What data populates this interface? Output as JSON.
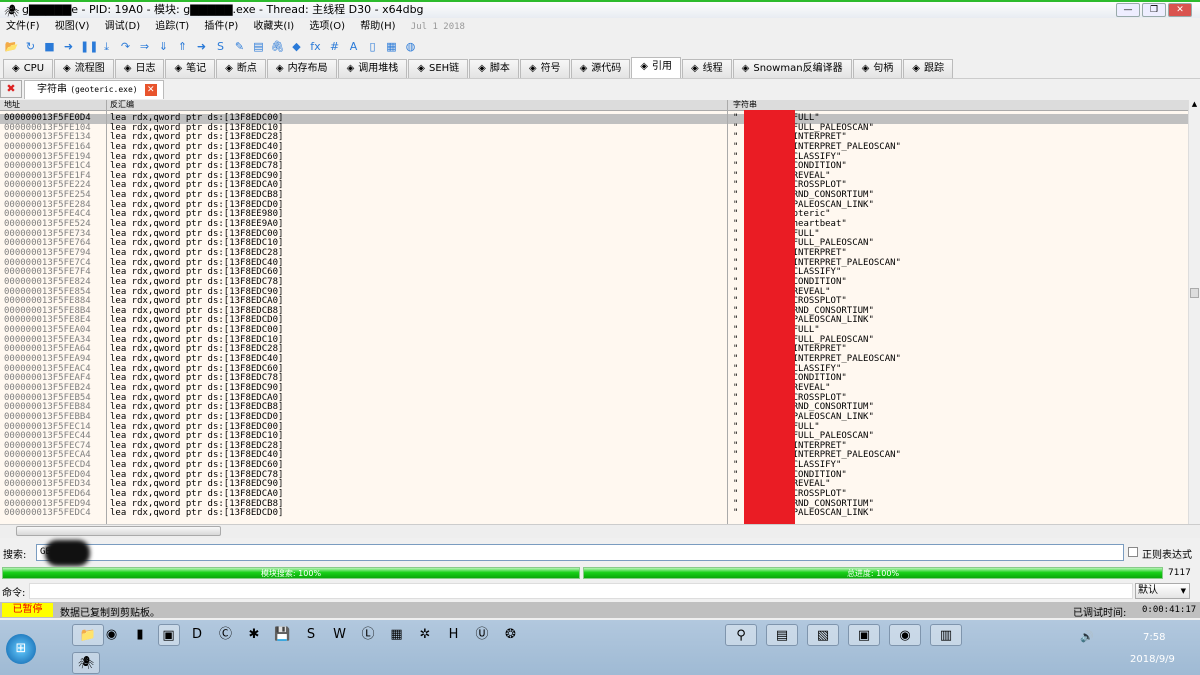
{
  "window": {
    "title": "g▇▇▇▇▇e - PID: 19A0 - 模块: g▇▇▇▇▇.exe - Thread: 主线程 D30 - x64dbg",
    "minimize": "—",
    "restore": "❐",
    "close": "✕"
  },
  "menu": {
    "items": [
      "文件(F)",
      "视图(V)",
      "调试(D)",
      "追踪(T)",
      "插件(P)",
      "收藏夹(I)",
      "选项(O)",
      "帮助(H)"
    ],
    "date": "Jul 1 2018"
  },
  "toolbar": {
    "icons": [
      "open-icon",
      "restart-icon",
      "stop-icon",
      "run-icon",
      "pause-icon",
      "step-into-icon",
      "step-over-icon",
      "trace-into-icon",
      "trace-over-icon",
      "execute-till-return-icon",
      "run-to-user-code-icon",
      "scylla-icon",
      "patch-icon",
      "comment-icon",
      "link-icon",
      "label-icon",
      "fx-icon",
      "hash-icon",
      "font-icon",
      "device-icon",
      "calculator-icon",
      "globe-icon"
    ],
    "glyphs": [
      "📂",
      "↻",
      "■",
      "➜",
      "❚❚",
      "⤓",
      "↷",
      "⇒",
      "⇓",
      "⇑",
      "➜",
      "S",
      "✎",
      "▤",
      "🖇",
      "◆",
      "fx",
      "#",
      "A",
      "▯",
      "▦",
      "◍"
    ]
  },
  "tabs": [
    {
      "label": "CPU",
      "icon": "cpu-icon"
    },
    {
      "label": "流程图",
      "icon": "tree-icon"
    },
    {
      "label": "日志",
      "icon": "log-icon"
    },
    {
      "label": "笔记",
      "icon": "notes-icon"
    },
    {
      "label": "断点",
      "icon": "breakpoint-icon"
    },
    {
      "label": "内存布局",
      "icon": "memory-icon"
    },
    {
      "label": "调用堆栈",
      "icon": "callstack-icon"
    },
    {
      "label": "SEH链",
      "icon": "seh-icon"
    },
    {
      "label": "脚本",
      "icon": "script-icon"
    },
    {
      "label": "符号",
      "icon": "symbol-icon"
    },
    {
      "label": "源代码",
      "icon": "source-icon"
    },
    {
      "label": "引用",
      "icon": "search-icon",
      "active": true
    },
    {
      "label": "线程",
      "icon": "thread-icon"
    },
    {
      "label": "Snowman反编译器",
      "icon": "snowman-icon"
    },
    {
      "label": "句柄",
      "icon": "handle-icon"
    },
    {
      "label": "跟踪",
      "icon": "trace-icon"
    }
  ],
  "subtab": {
    "label": "字符串",
    "module": "(geoteric.exe)",
    "close": "✕",
    "close_all": "✖"
  },
  "grid": {
    "headers": [
      "地址",
      "反汇编",
      "字符串"
    ],
    "addresses": [
      "000000013F5FE0D4",
      "000000013F5FE104",
      "000000013F5FE134",
      "000000013F5FE164",
      "000000013F5FE194",
      "000000013F5FE1C4",
      "000000013F5FE1F4",
      "000000013F5FE224",
      "000000013F5FE254",
      "000000013F5FE284",
      "000000013F5FE4C4",
      "000000013F5FE524",
      "000000013F5FE734",
      "000000013F5FE764",
      "000000013F5FE794",
      "000000013F5FE7C4",
      "000000013F5FE7F4",
      "000000013F5FE824",
      "000000013F5FE854",
      "000000013F5FE884",
      "000000013F5FE8B4",
      "000000013F5FE8E4",
      "000000013F5FEA04",
      "000000013F5FEA34",
      "000000013F5FEA64",
      "000000013F5FEA94",
      "000000013F5FEAC4",
      "000000013F5FEAF4",
      "000000013F5FEB24",
      "000000013F5FEB54",
      "000000013F5FEB84",
      "000000013F5FEBB4",
      "000000013F5FEC14",
      "000000013F5FEC44",
      "000000013F5FEC74",
      "000000013F5FECA4",
      "000000013F5FECD4",
      "000000013F5FED04",
      "000000013F5FED34",
      "000000013F5FED64",
      "000000013F5FED94",
      "000000013F5FEDC4"
    ],
    "instruction_prefix": "lea rdx,qword ptr ds:",
    "operands": [
      "13F8EDC00",
      "13F8EDC10",
      "13F8EDC28",
      "13F8EDC40",
      "13F8EDC60",
      "13F8EDC78",
      "13F8EDC90",
      "13F8EDCA0",
      "13F8EDCB8",
      "13F8EDCD0",
      "13F8EE980",
      "13F8EE9A0",
      "13F8EDC00",
      "13F8EDC10",
      "13F8EDC28",
      "13F8EDC40",
      "13F8EDC60",
      "13F8EDC78",
      "13F8EDC90",
      "13F8EDCA0",
      "13F8EDCB8",
      "13F8EDCD0",
      "13F8EDC00",
      "13F8EDC10",
      "13F8EDC28",
      "13F8EDC40",
      "13F8EDC60",
      "13F8EDC78",
      "13F8EDC90",
      "13F8EDCA0",
      "13F8EDCB8",
      "13F8EDCD0",
      "13F8EDC00",
      "13F8EDC10",
      "13F8EDC28",
      "13F8EDC40",
      "13F8EDC60",
      "13F8EDC78",
      "13F8EDC90",
      "13F8EDCA0",
      "13F8EDCB8",
      "13F8EDCD0"
    ],
    "strings": [
      "FULL\"",
      "FULL_PALEOSCAN\"",
      "INTERPRET\"",
      "INTERPRET_PALEOSCAN\"",
      "CLASSIFY\"",
      "CONDITION\"",
      "REVEAL\"",
      "CROSSPLOT\"",
      "RND_CONSORTIUM\"",
      "PALEOSCAN_LINK\"",
      "oteric\"",
      "heartbeat\"",
      "FULL\"",
      "FULL_PALEOSCAN\"",
      "INTERPRET\"",
      "INTERPRET_PALEOSCAN\"",
      "CLASSIFY\"",
      "CONDITION\"",
      "REVEAL\"",
      "CROSSPLOT\"",
      "RND_CONSORTIUM\"",
      "PALEOSCAN_LINK\"",
      "FULL\"",
      "FULL_PALEOSCAN\"",
      "INTERPRET\"",
      "INTERPRET_PALEOSCAN\"",
      "CLASSIFY\"",
      "CONDITION\"",
      "REVEAL\"",
      "CROSSPLOT\"",
      "RND_CONSORTIUM\"",
      "PALEOSCAN_LINK\"",
      "FULL\"",
      "FULL_PALEOSCAN\"",
      "INTERPRET\"",
      "INTERPRET_PALEOSCAN\"",
      "CLASSIFY\"",
      "CONDITION\"",
      "REVEAL\"",
      "CROSSPLOT\"",
      "RND_CONSORTIUM\"",
      "PALEOSCAN_LINK\""
    ],
    "selected_index": 0
  },
  "search": {
    "label": "搜索:",
    "value": "GE",
    "regex_label": "正则表达式"
  },
  "progress": {
    "module_label": "模块搜索: 100%",
    "module_percent": 100,
    "total_label": "总进度: 100%",
    "total_percent": 100,
    "count": "7117"
  },
  "command": {
    "label": "命令:",
    "mode": "默认"
  },
  "status": {
    "state": "已暂停",
    "message": "数据已复制到剪贴板。",
    "debug_time_label": "已调试时间:",
    "debug_time": "0:00:41:17"
  },
  "taskbar": {
    "time": "7:58",
    "date": "2018/9/9",
    "apps": [
      "explorer-icon",
      "chrome-icon",
      "app-icon",
      "app-icon",
      "app-icon",
      "app-icon",
      "app-icon",
      "save-icon",
      "skype-icon",
      "word-icon",
      "app-icon",
      "app-icon",
      "app-icon",
      "hex-editor-icon",
      "app-icon",
      "app-icon",
      "search-icon",
      "app-icon",
      "app-icon",
      "app-icon",
      "chrome-icon",
      "app-icon"
    ],
    "glyphs": [
      "📁",
      "◉",
      "▮",
      "▣",
      "D",
      "Ⓒ",
      "✱",
      "💾",
      "S",
      "W",
      "Ⓛ",
      "▦",
      "✲",
      "H",
      "Ⓤ",
      "❂",
      "⚲",
      "▤",
      "▧",
      "▣",
      "◉",
      "▥"
    ]
  }
}
